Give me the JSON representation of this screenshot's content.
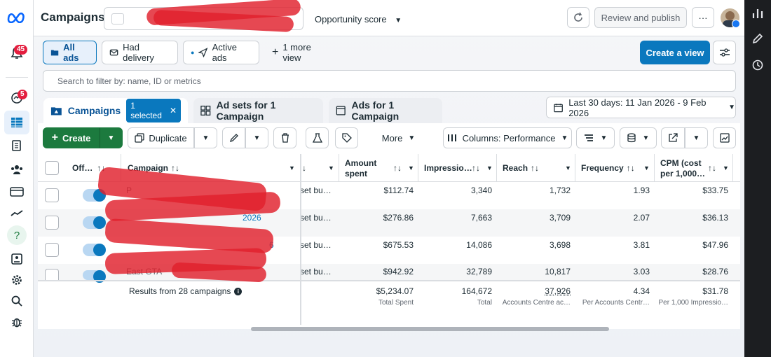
{
  "header": {
    "title": "Campaigns",
    "opportunity_label": "Opportunity score",
    "review_publish": "Review and publish",
    "more": "···"
  },
  "nav": {
    "notifications_badge": "45",
    "messages_badge": "5"
  },
  "views": {
    "all_ads": "All ads",
    "had_delivery": "Had delivery",
    "active_ads": "Active ads",
    "more_view": "1 more view",
    "create_view": "Create a view"
  },
  "search": {
    "placeholder": "Search to filter by: name, ID or metrics"
  },
  "level_tabs": {
    "campaigns": "Campaigns",
    "selected": "1 selected",
    "adsets": "Ad sets for 1 Campaign",
    "ads": "Ads for 1 Campaign"
  },
  "date_range": "Last 30 days: 11 Jan 2026 - 9 Feb 2026",
  "toolbar": {
    "create": "Create",
    "duplicate": "Duplicate",
    "more": "More",
    "columns": "Columns: Performance"
  },
  "table": {
    "headers": {
      "off": "Off…",
      "campaign": "Campaign",
      "amount_spent_1": "Amount",
      "amount_spent_2": "spent",
      "impressions": "Impressio…",
      "reach": "Reach",
      "frequency": "Frequency",
      "cpm_1": "CPM (cost",
      "cpm_2": "per 1,000…"
    },
    "rows": [
      {
        "name": "P",
        "budget": "set bu…",
        "amount": "$112.74",
        "impressions": "3,340",
        "reach": "1,732",
        "frequency": "1.93",
        "cpm": "$33.75"
      },
      {
        "name": "2026",
        "budget": "set bu…",
        "amount": "$276.86",
        "impressions": "7,663",
        "reach": "3,709",
        "frequency": "2.07",
        "cpm": "$36.13"
      },
      {
        "name": "6",
        "budget": "set bu…",
        "amount": "$675.53",
        "impressions": "14,086",
        "reach": "3,698",
        "frequency": "3.81",
        "cpm": "$47.96"
      },
      {
        "name": "East GTA",
        "budget": "set bu…",
        "amount": "$942.92",
        "impressions": "32,789",
        "reach": "10,817",
        "frequency": "3.03",
        "cpm": "$28.76"
      }
    ],
    "footer": {
      "results": "Results from 28 campaigns",
      "amount": "$5,234.07",
      "amount_sub": "Total Spent",
      "impressions": "164,672",
      "impressions_sub": "Total",
      "reach": "37,926",
      "reach_sub": "Accounts Centre ac…",
      "frequency": "4.34",
      "frequency_sub": "Per Accounts Centr…",
      "cpm": "$31.78",
      "cpm_sub": "Per 1,000 Impressio…"
    }
  },
  "colors": {
    "accent": "#0a78be",
    "create": "#1c7a3e",
    "badge": "#e41e3f"
  }
}
